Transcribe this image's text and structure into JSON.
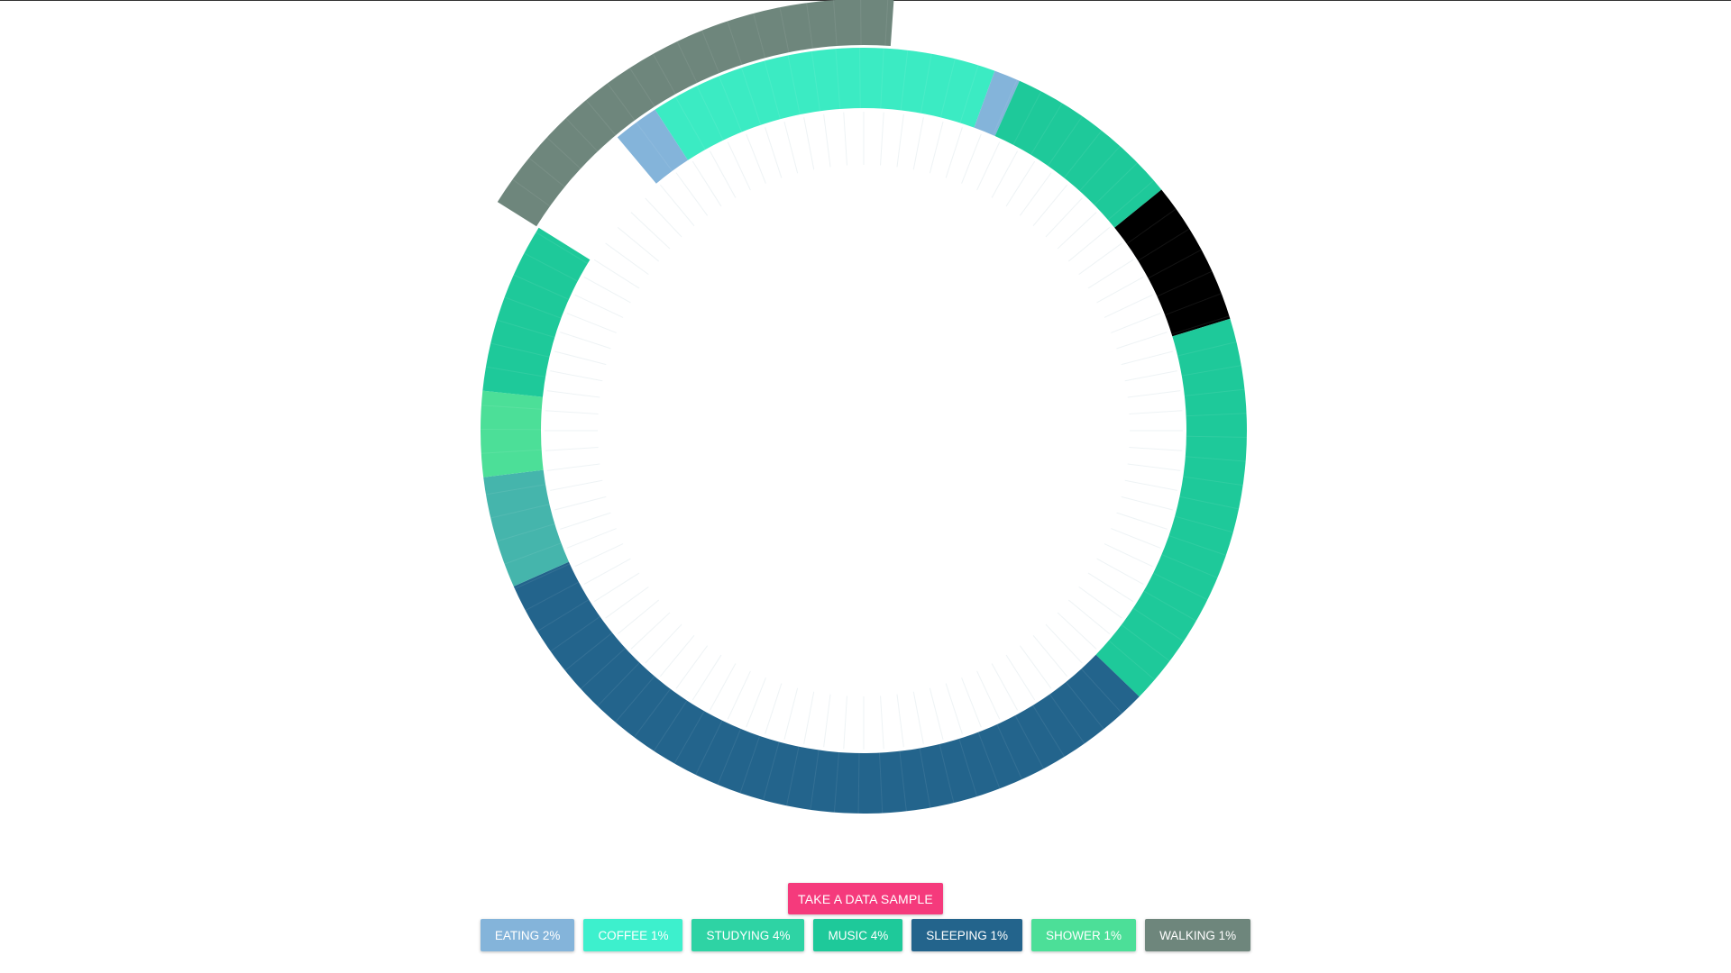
{
  "controls": {
    "sample_button_label": "TAKE A DATA SAMPLE",
    "sample_button_color": "#f53a7c"
  },
  "legend": [
    {
      "key": "eating",
      "label": "EATING 2%",
      "color": "#84b4da"
    },
    {
      "key": "coffee",
      "label": "COFFEE 1%",
      "color": "#3df0cd"
    },
    {
      "key": "studying",
      "label": "STUDYING 4%",
      "color": "#2ed3a4"
    },
    {
      "key": "music",
      "label": "MUSIC 4%",
      "color": "#1ec99a"
    },
    {
      "key": "sleeping",
      "label": "SLEEPING 1%",
      "color": "#23648c"
    },
    {
      "key": "shower",
      "label": "SHOWER 1%",
      "color": "#4cdf98"
    },
    {
      "key": "walking",
      "label": "WALKING 1%",
      "color": "#6e867c"
    }
  ],
  "ring_colors": {
    "eating": "#84b4da",
    "coffee": "#3bebc3",
    "music": "#1ec99a",
    "studying": "#45b5ac",
    "sleeping": "#23648c",
    "shower": "#4cdf98",
    "walking": "#6e867c",
    "other": "#000000"
  },
  "ring_segments": [
    {
      "activity": "coffee",
      "from_deg": 327,
      "to_deg": 20
    },
    {
      "activity": "eating",
      "from_deg": 20,
      "to_deg": 24
    },
    {
      "activity": "music",
      "from_deg": 24,
      "to_deg": 51
    },
    {
      "activity": "other",
      "from_deg": 51,
      "to_deg": 73
    },
    {
      "activity": "music",
      "from_deg": 73,
      "to_deg": 134
    },
    {
      "activity": "sleeping",
      "from_deg": 134,
      "to_deg": 246
    },
    {
      "activity": "studying",
      "from_deg": 246,
      "to_deg": 263
    },
    {
      "activity": "shower",
      "from_deg": 263,
      "to_deg": 276
    },
    {
      "activity": "music",
      "from_deg": 276,
      "to_deg": 302
    },
    {
      "activity": "eating",
      "from_deg": 320,
      "to_deg": 327
    },
    {
      "activity": "walking",
      "from_deg": 302,
      "to_deg": 364,
      "outer": true
    }
  ]
}
